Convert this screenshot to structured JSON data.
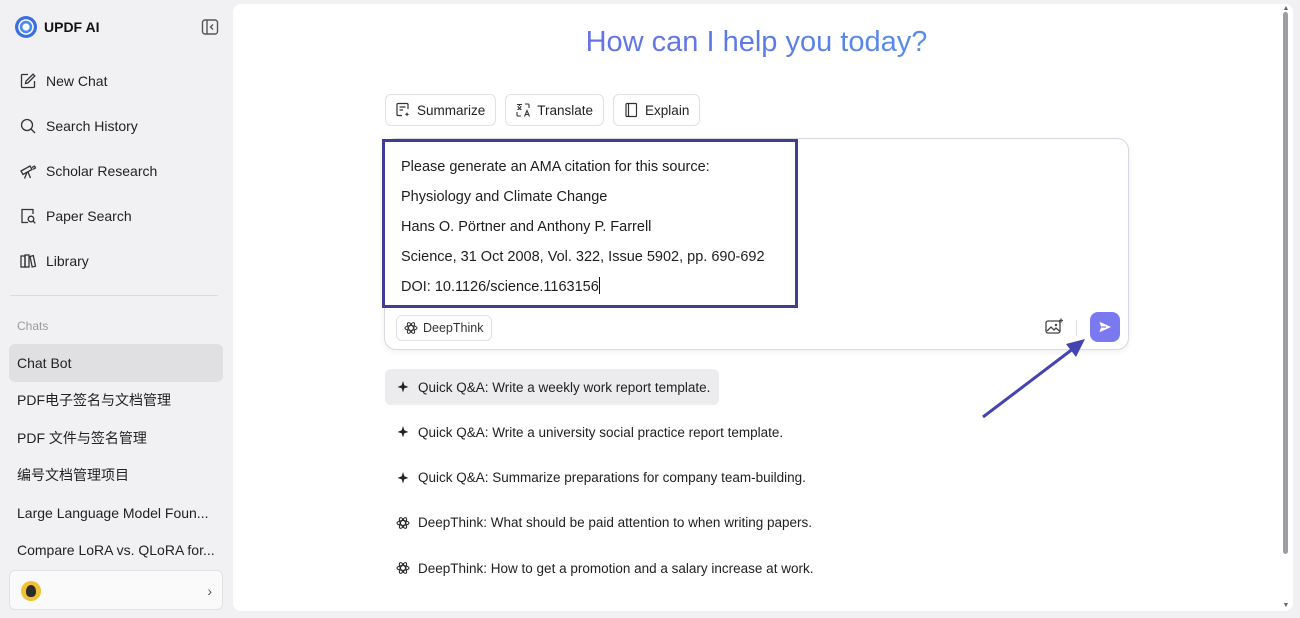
{
  "app": {
    "name": "UPDF AI"
  },
  "sidebar": {
    "nav": [
      {
        "label": "New Chat",
        "icon": "edit-icon"
      },
      {
        "label": "Search History",
        "icon": "search-icon"
      },
      {
        "label": "Scholar Research",
        "icon": "telescope-icon"
      },
      {
        "label": "Paper Search",
        "icon": "paper-search-icon"
      },
      {
        "label": "Library",
        "icon": "library-icon"
      }
    ],
    "chats_title": "Chats",
    "chats": [
      "Chat Bot",
      "PDF电子签名与文档管理",
      "PDF 文件与签名管理",
      "编号文档管理项目",
      "Large Language Model Foun...",
      "Compare LoRA vs. QLoRA for..."
    ]
  },
  "main": {
    "headline": "How can I help you today?",
    "chips": [
      "Summarize",
      "Translate",
      "Explain"
    ],
    "input_lines": [
      "Please generate an AMA citation for this source:",
      "Physiology and Climate Change",
      "Hans O. Pörtner and Anthony P. Farrell",
      "Science, 31 Oct 2008, Vol. 322, Issue 5902, pp. 690-692",
      "DOI: 10.1126/science.1163156"
    ],
    "deepthink_label": "DeepThink",
    "suggestions": [
      {
        "text": "Quick Q&A: Write a weekly work report template.",
        "icon": "sparkle-icon"
      },
      {
        "text": "Quick Q&A: Write a university social practice report template.",
        "icon": "sparkle-icon"
      },
      {
        "text": "Quick Q&A: Summarize preparations for company team-building.",
        "icon": "sparkle-icon"
      },
      {
        "text": "DeepThink: What should be paid attention to when writing papers.",
        "icon": "atom-icon"
      },
      {
        "text": "DeepThink: How to get a promotion and a salary increase at work.",
        "icon": "atom-icon"
      }
    ]
  },
  "colors": {
    "accent": "#7b79ef",
    "highlight_border": "#3f3e96",
    "arrow": "#4444b0"
  }
}
